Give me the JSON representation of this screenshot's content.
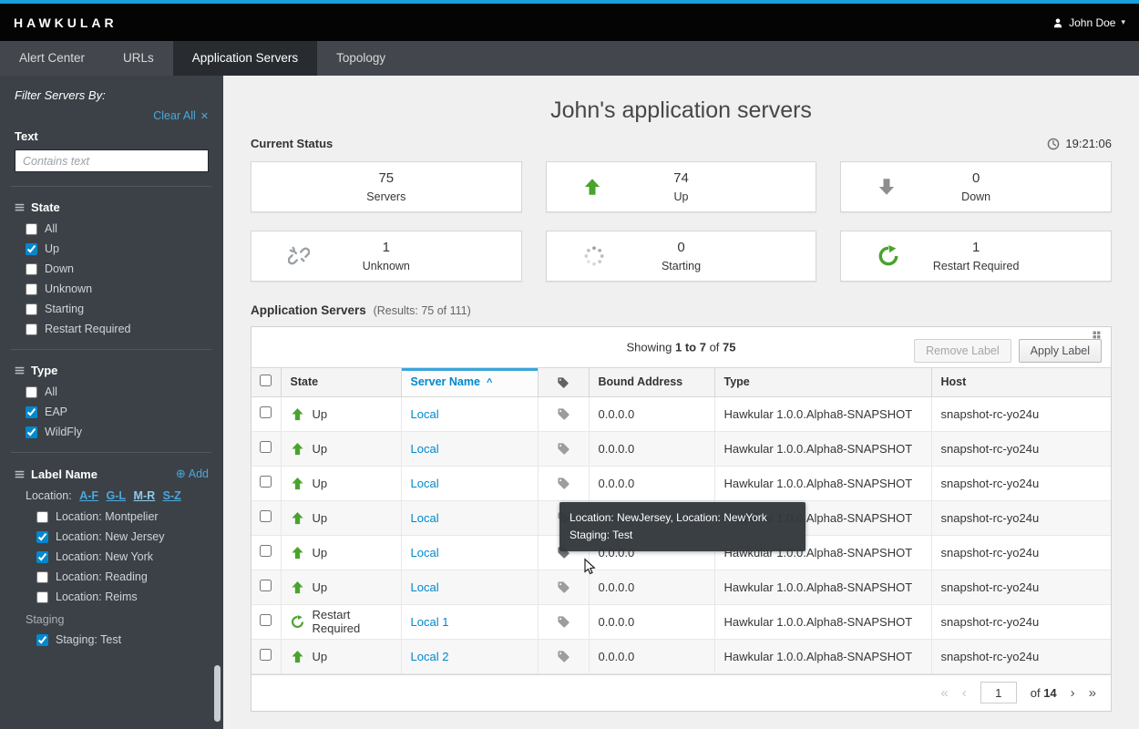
{
  "topbar": {
    "brand": "HAWKULAR",
    "user_name": "John Doe"
  },
  "nav": {
    "tabs": [
      "Alert Center",
      "URLs",
      "Application Servers",
      "Topology"
    ]
  },
  "icons": {
    "caret_down": "▾",
    "close": "✕",
    "plus_circle": "⊕",
    "sort_asc": "^",
    "page_first": "«",
    "page_prev": "‹",
    "page_next": "›",
    "page_last": "»"
  },
  "colors": {
    "masthead_blue": "#199fd9",
    "accent_blue": "#0088ce",
    "sidebar_link_blue": "#4aa8dc",
    "success_green": "#4aa32c",
    "down_gray": "#8b8d8f"
  },
  "sidebar": {
    "title": "Filter Servers By:",
    "clear_all_label": "Clear All",
    "text_label": "Text",
    "text_placeholder": "Contains text",
    "state": {
      "title": "State",
      "items": [
        {
          "label": "All",
          "checked": false
        },
        {
          "label": "Up",
          "checked": true
        },
        {
          "label": "Down",
          "checked": false
        },
        {
          "label": "Unknown",
          "checked": false
        },
        {
          "label": "Starting",
          "checked": false
        },
        {
          "label": "Restart Required",
          "checked": false
        }
      ]
    },
    "type": {
      "title": "Type",
      "items": [
        {
          "label": "All",
          "checked": false
        },
        {
          "label": "EAP",
          "checked": true
        },
        {
          "label": "WildFly",
          "checked": true
        }
      ]
    },
    "labels": {
      "title": "Label Name",
      "add_label": "Add",
      "location_prefix": "Location:",
      "ranges": [
        "A-F",
        "G-L",
        "M-R",
        "S-Z"
      ],
      "items": [
        {
          "label": "Location: Montpelier",
          "checked": false
        },
        {
          "label": "Location: New Jersey",
          "checked": true
        },
        {
          "label": "Location: New York",
          "checked": true
        },
        {
          "label": "Location: Reading",
          "checked": false
        },
        {
          "label": "Location: Reims",
          "checked": false
        }
      ],
      "staging_title": "Staging",
      "staging_items": [
        {
          "label": "Staging: Test",
          "checked": true
        }
      ]
    }
  },
  "main": {
    "page_title": "John's application servers",
    "current_status_label": "Current Status",
    "clock_time": "19:21:06",
    "cards": [
      {
        "value": "75",
        "label": "Servers"
      },
      {
        "value": "74",
        "label": "Up"
      },
      {
        "value": "0",
        "label": "Down"
      },
      {
        "value": "1",
        "label": "Unknown"
      },
      {
        "value": "0",
        "label": "Starting"
      },
      {
        "value": "1",
        "label": "Restart Required"
      }
    ],
    "servers_heading": "Application Servers",
    "servers_results": "(Results: 75 of 111)"
  },
  "table": {
    "showing_prefix": "Showing",
    "showing_range": "1 to 7",
    "showing_of": "of",
    "showing_total": "75",
    "remove_label_btn": "Remove Label",
    "apply_label_btn": "Apply Label",
    "col_state": "State",
    "col_server_name": "Server Name",
    "col_bound_address": "Bound Address",
    "col_type": "Type",
    "col_host": "Host",
    "rows": [
      {
        "state": "Up",
        "name": "Local",
        "address": "0.0.0.0",
        "type": "Hawkular 1.0.0.Alpha8-SNAPSHOT",
        "host": "snapshot-rc-yo24u"
      },
      {
        "state": "Up",
        "name": "Local",
        "address": "0.0.0.0",
        "type": "Hawkular 1.0.0.Alpha8-SNAPSHOT",
        "host": "snapshot-rc-yo24u"
      },
      {
        "state": "Up",
        "name": "Local",
        "address": "0.0.0.0",
        "type": "Hawkular 1.0.0.Alpha8-SNAPSHOT",
        "host": "snapshot-rc-yo24u"
      },
      {
        "state": "Up",
        "name": "Local",
        "address": "0.0.0.0",
        "type": "Hawkular 1.0.0.Alpha8-SNAPSHOT",
        "host": "snapshot-rc-yo24u"
      },
      {
        "state": "Up",
        "name": "Local",
        "address": "0.0.0.0",
        "type": "Hawkular 1.0.0.Alpha8-SNAPSHOT",
        "host": "snapshot-rc-yo24u"
      },
      {
        "state": "Up",
        "name": "Local",
        "address": "0.0.0.0",
        "type": "Hawkular 1.0.0.Alpha8-SNAPSHOT",
        "host": "snapshot-rc-yo24u"
      },
      {
        "state": "Restart Required",
        "name": "Local 1",
        "address": "0.0.0.0",
        "type": "Hawkular 1.0.0.Alpha8-SNAPSHOT",
        "host": "snapshot-rc-yo24u"
      },
      {
        "state": "Up",
        "name": "Local 2",
        "address": "0.0.0.0",
        "type": "Hawkular 1.0.0.Alpha8-SNAPSHOT",
        "host": "snapshot-rc-yo24u"
      }
    ],
    "pagination": {
      "page_value": "1",
      "of_label": "of",
      "total": "14"
    }
  },
  "tooltip": {
    "line1": "Location: NewJersey, Location: NewYork",
    "line2": "Staging: Test"
  }
}
